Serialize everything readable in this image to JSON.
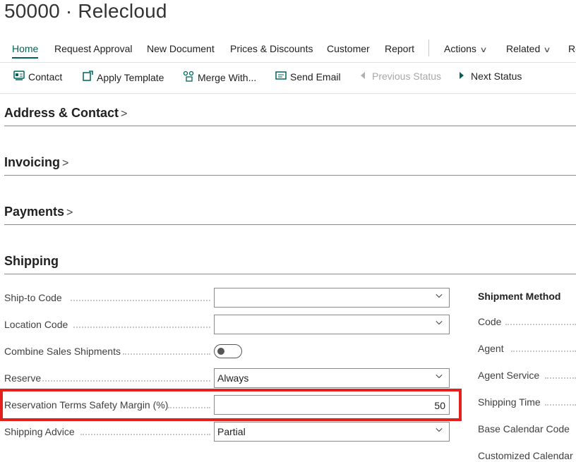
{
  "page": {
    "title": "50000 · Relecloud"
  },
  "nav": {
    "items": [
      "Home",
      "Request Approval",
      "New Document",
      "Prices & Discounts",
      "Customer",
      "Report",
      "Actions",
      "Related",
      "Re"
    ]
  },
  "actions": {
    "contact": "Contact",
    "apply_template": "Apply Template",
    "merge_with": "Merge With...",
    "send_email": "Send Email",
    "previous_status": "Previous Status",
    "next_status": "Next Status"
  },
  "sections": {
    "address_contact": "Address & Contact",
    "invoicing": "Invoicing",
    "payments": "Payments",
    "shipping": "Shipping"
  },
  "shipping": {
    "ship_to_code": {
      "label": "Ship-to Code",
      "value": ""
    },
    "location_code": {
      "label": "Location Code",
      "value": ""
    },
    "combine_sales_shipments": {
      "label": "Combine Sales Shipments",
      "enabled": false
    },
    "reserve": {
      "label": "Reserve",
      "value": "Always"
    },
    "reservation_margin": {
      "label": "Reservation Terms Safety Margin (%)",
      "value": "50"
    },
    "shipping_advice": {
      "label": "Shipping Advice",
      "value": "Partial"
    }
  },
  "shipment_method": {
    "heading": "Shipment Method",
    "labels": [
      "Code",
      "Agent",
      "Agent Service",
      "Shipping Time",
      "Base Calendar Code",
      "Customized Calendar"
    ]
  },
  "colors": {
    "accent": "#00635b",
    "highlight": "#e2201c"
  }
}
